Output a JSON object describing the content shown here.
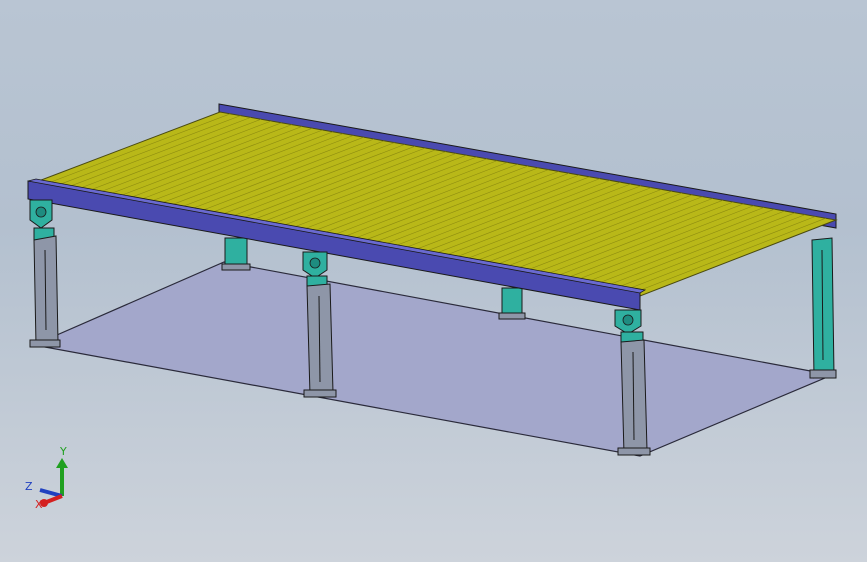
{
  "viewport": {
    "background_top": "#b9c5d3",
    "background_bottom": "#cdd3db"
  },
  "model": {
    "conveyor_surface_color": "#b9b818",
    "roller_line_color": "#8d8c10",
    "side_rail_color": "#4a4ab0",
    "leg_color": "#8e96a8",
    "bracket_color": "#2fb0a0",
    "floor_plate_color": "#a4a8cc"
  },
  "triad": {
    "x_label": "X",
    "y_label": "Y",
    "z_label": "Z",
    "x_color": "#d42020",
    "y_color": "#20a020",
    "z_color": "#2040c0"
  }
}
